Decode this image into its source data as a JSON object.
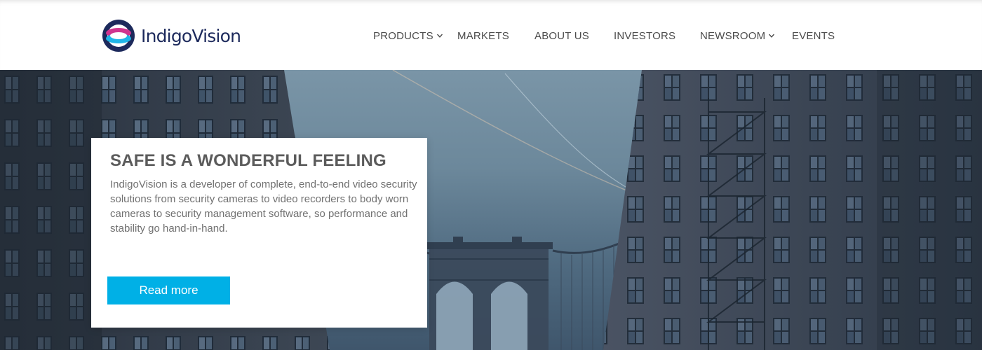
{
  "brand": {
    "logo_text": "IndigoVision",
    "colors": {
      "navy": "#1d2a5c",
      "magenta": "#d0358f",
      "cyan": "#1fb6e8",
      "accent": "#00b0e6"
    }
  },
  "nav": {
    "items": [
      {
        "label": "PRODUCTS",
        "has_dropdown": true
      },
      {
        "label": "MARKETS",
        "has_dropdown": false
      },
      {
        "label": "ABOUT US",
        "has_dropdown": false
      },
      {
        "label": "INVESTORS",
        "has_dropdown": false
      },
      {
        "label": "NEWSROOM",
        "has_dropdown": true
      },
      {
        "label": "EVENTS",
        "has_dropdown": false
      }
    ]
  },
  "hero": {
    "title": "SAFE IS A WONDERFUL FEELING",
    "body": "IndigoVision is a developer of complete, end-to-end video security solutions from security cameras to video recorders to body worn cameras to security management software, so performance and stability go hand-in-hand.",
    "button_label": "Read more"
  }
}
